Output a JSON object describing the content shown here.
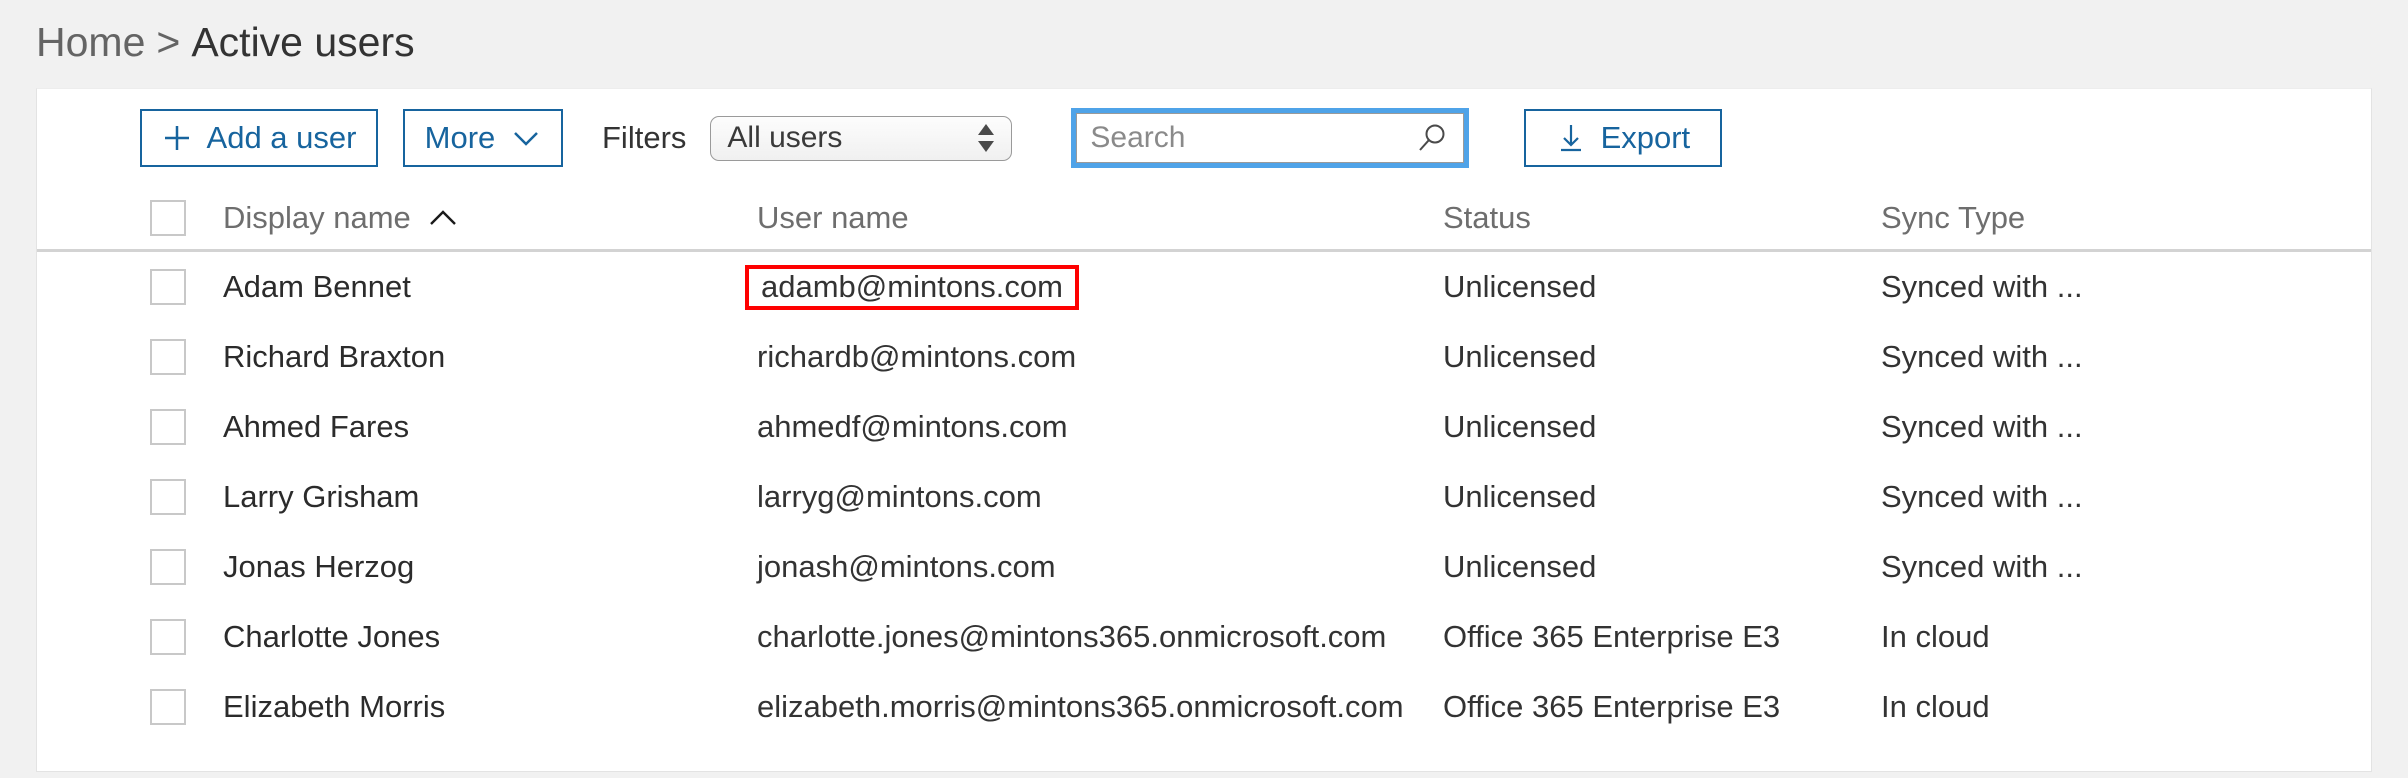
{
  "breadcrumb": {
    "home": "Home",
    "separator": ">",
    "current": "Active users"
  },
  "toolbar": {
    "add_user_label": "Add a user",
    "add_user_icon": "plus-icon",
    "more_label": "More",
    "more_icon": "chevron-down-icon",
    "filters_label": "Filters",
    "filter_selected": "All users",
    "filter_options": [
      "All users"
    ],
    "search_placeholder": "Search",
    "search_value": "",
    "search_icon": "search-icon",
    "export_label": "Export",
    "export_icon": "download-icon"
  },
  "table": {
    "columns": [
      {
        "key": "display_name",
        "label": "Display name",
        "sorted": "ascending",
        "sort_icon": "caret-up-icon"
      },
      {
        "key": "user_name",
        "label": "User name",
        "sorted": "none"
      },
      {
        "key": "status",
        "label": "Status",
        "sorted": "none"
      },
      {
        "key": "sync_type",
        "label": "Sync Type",
        "sorted": "none"
      }
    ],
    "rows": [
      {
        "display_name": "Adam Bennet",
        "user_name": "adamb@mintons.com",
        "status": "Unlicensed",
        "sync_type": "Synced with ...",
        "highlighted": true
      },
      {
        "display_name": "Richard Braxton",
        "user_name": "richardb@mintons.com",
        "status": "Unlicensed",
        "sync_type": "Synced with ...",
        "highlighted": false
      },
      {
        "display_name": "Ahmed Fares",
        "user_name": "ahmedf@mintons.com",
        "status": "Unlicensed",
        "sync_type": "Synced with ...",
        "highlighted": false
      },
      {
        "display_name": "Larry Grisham",
        "user_name": "larryg@mintons.com",
        "status": "Unlicensed",
        "sync_type": "Synced with ...",
        "highlighted": false
      },
      {
        "display_name": "Jonas Herzog",
        "user_name": "jonash@mintons.com",
        "status": "Unlicensed",
        "sync_type": "Synced with ...",
        "highlighted": false
      },
      {
        "display_name": "Charlotte Jones",
        "user_name": "charlotte.jones@mintons365.onmicrosoft.com",
        "status": "Office 365 Enterprise E3",
        "sync_type": "In cloud",
        "highlighted": false
      },
      {
        "display_name": "Elizabeth Morris",
        "user_name": "elizabeth.morris@mintons365.onmicrosoft.com",
        "status": "Office 365 Enterprise E3",
        "sync_type": "In cloud",
        "highlighted": false
      }
    ]
  },
  "colors": {
    "accent_blue": "#17649e",
    "focus_ring": "#4fa3e8",
    "annotation_red": "#fe0000",
    "page_background": "#f1f1f1",
    "card_background": "#ffffff",
    "header_text": "#6e6e6e"
  }
}
